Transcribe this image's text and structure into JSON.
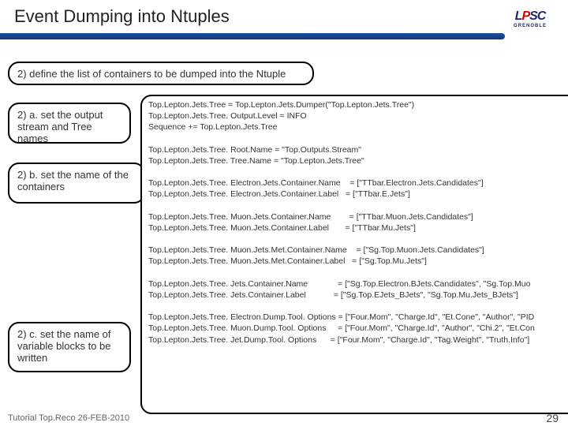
{
  "header": {
    "title": "Event Dumping into Ntuples",
    "logo_top": "LPSC",
    "logo_sub": "GRENOBLE"
  },
  "steps": {
    "main": "2) define the list of containers to be dumped into the Ntuple",
    "a": "2) a. set the output stream and Tree names",
    "b": "2) b. set the name of the containers",
    "c": "2) c. set the name of variable blocks to be written"
  },
  "code": "Top.Lepton.Jets.Tree = Top.Lepton.Jets.Dumper(\"Top.Lepton.Jets.Tree\")\nTop.Lepton.Jets.Tree. Output.Level = INFO\nSequence += Top.Lepton.Jets.Tree\n\nTop.Lepton.Jets.Tree. Root.Name = \"Top.Outputs.Stream\"\nTop.Lepton.Jets.Tree. Tree.Name = \"Top.Lepton.Jets.Tree\"\n\nTop.Lepton.Jets.Tree. Electron.Jets.Container.Name    = [\"TTbar.Electron.Jets.Candidates\"]\nTop.Lepton.Jets.Tree. Electron.Jets.Container.Label   = [\"TTbar.E.Jets\"]\n\nTop.Lepton.Jets.Tree. Muon.Jets.Container.Name        = [\"TTbar.Muon.Jets.Candidates\"]\nTop.Lepton.Jets.Tree. Muon.Jets.Container.Label       = [\"TTbar.Mu.Jets\"]\n\nTop.Lepton.Jets.Tree. Muon.Jets.Met.Container.Name    = [\"Sg.Top.Muon.Jets.Candidates\"]\nTop.Lepton.Jets.Tree. Muon.Jets.Met.Container.Label   = [\"Sg.Top.Mu.Jets\"]\n\nTop.Lepton.Jets.Tree. Jets.Container.Name             = [\"Sg.Top.Electron.BJets.Candidates\", \"Sg.Top.Muo\nTop.Lepton.Jets.Tree. Jets.Container.Label            = [\"Sg.Top.EJets_BJets\", \"Sg.Top.Mu.Jets_BJets\"]\n\nTop.Lepton.Jets.Tree. Electron.Dump.Tool. Options = [\"Four.Mom\", \"Charge.Id\", \"Et.Cone\", \"Author\", \"PID\nTop.Lepton.Jets.Tree. Muon.Dump.Tool. Options     = [\"Four.Mom\", \"Charge.Id\", \"Author\", \"Chi.2\", \"Et.Con\nTop.Lepton.Jets.Tree. Jet.Dump.Tool. Options      = [\"Four.Mom\", \"Charge.Id\", \"Tag.Weight\", \"Truth.Info\"]",
  "footer": {
    "text": "Tutorial Top.Reco 26-FEB-2010",
    "page": "29"
  }
}
